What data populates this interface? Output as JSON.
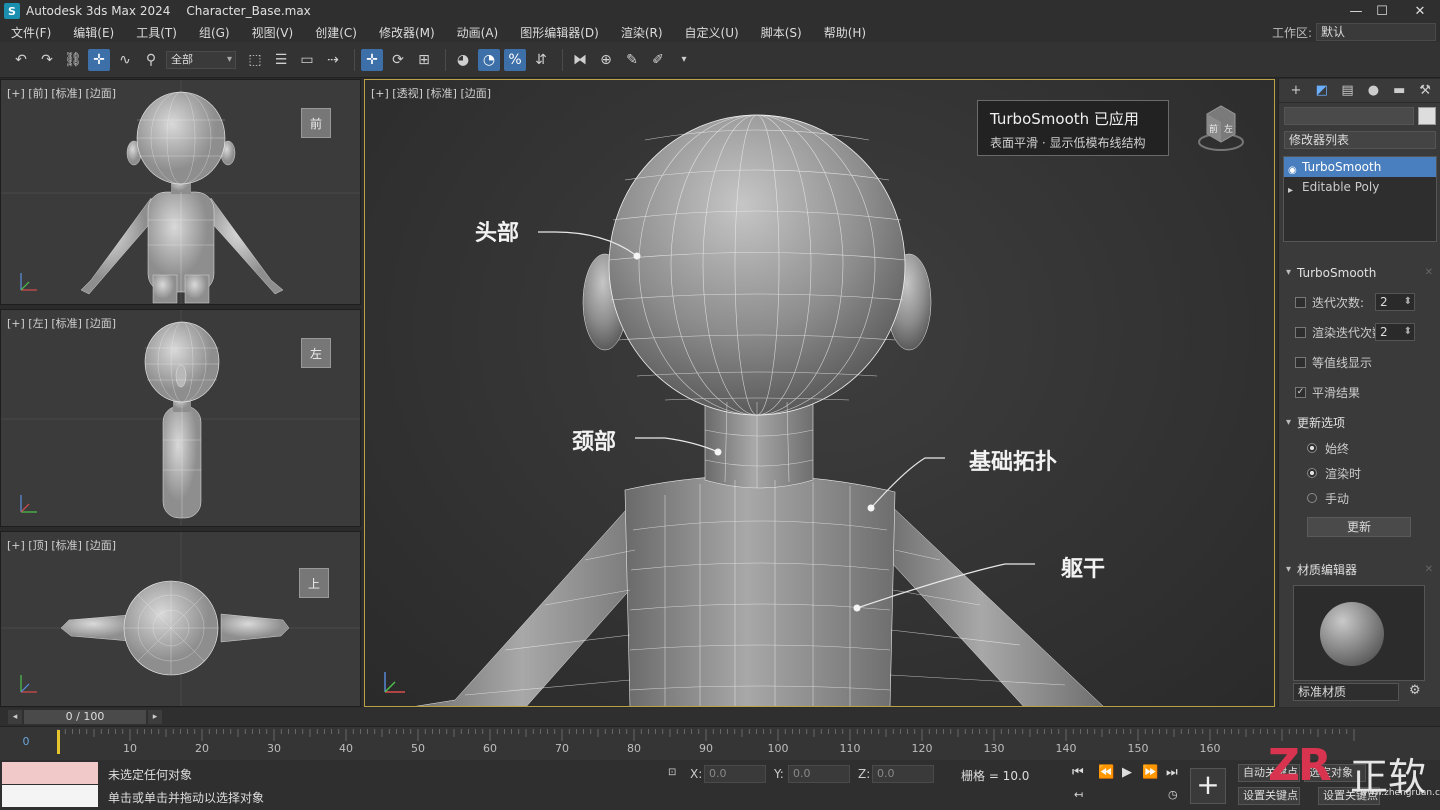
{
  "titlebar": {
    "app_name": "Autodesk 3ds Max 2024",
    "file_name": "Character_Base.max",
    "logo": "3ds-max-logo"
  },
  "menu": [
    "文件(F)",
    "编辑(E)",
    "工具(T)",
    "组(G)",
    "视图(V)",
    "创建(C)",
    "修改器(M)",
    "动画(A)",
    "图形编辑器(D)",
    "渲染(R)",
    "自定义(U)",
    "脚本(S)",
    "帮助(H)"
  ],
  "workspace": {
    "label": "工作区:",
    "value": "默认"
  },
  "toolbar": {
    "selection_filter": "全部"
  },
  "viewports": {
    "front": {
      "label": "[+] [前] [标准] [边面]",
      "cube": "前"
    },
    "left": {
      "label": "[+] [左] [标准] [边面]",
      "cube": "左"
    },
    "top": {
      "label": "[+] [顶] [标准] [边面]",
      "cube": "上"
    },
    "persp": {
      "label": "[+] [透视] [标准] [边面]",
      "cube_front": "左",
      "cube_side": "前"
    }
  },
  "callout": {
    "title": "TurboSmooth 已应用",
    "subtitle": "表面平滑 · 显示低模布线结构"
  },
  "annotations": {
    "head": "头部",
    "neck": "颈部",
    "topology": "基础拓扑",
    "torso": "躯干"
  },
  "command_panel": {
    "modifier_list": "修改器列表",
    "stack": [
      "TurboSmooth",
      "Editable Poly"
    ],
    "turbosmooth": {
      "title": "TurboSmooth",
      "iterations_label": "迭代次数:",
      "iterations_value": "2",
      "render_iters_label": "渲染迭代次数:",
      "render_iters_value": "2",
      "isoline_label": "等值线显示",
      "smooth_result_label": "平滑结果",
      "update_options_title": "更新选项",
      "update_always": "始终",
      "update_render": "渲染时",
      "update_manual": "手动",
      "update_button": "更新"
    },
    "material_editor": {
      "title": "材质编辑器",
      "type": "标准材质"
    }
  },
  "timeline": {
    "slider": "0 / 100",
    "cursor_frame": "0",
    "frames": [
      "10",
      "20",
      "30",
      "40",
      "50",
      "60",
      "70",
      "80",
      "90",
      "100",
      "110",
      "120",
      "130",
      "140",
      "150",
      "160"
    ]
  },
  "status": {
    "line1": "未选定任何对象",
    "line2": "单击或单击并拖动以选择对象",
    "x_label": "X:",
    "y_label": "Y:",
    "z_label": "Z:",
    "x_value": "0.0",
    "y_value": "0.0",
    "z_value": "0.0",
    "grid": "栅格 = 10.0",
    "auto_key": "自动关键点",
    "selected": "选定对象",
    "set_key": "设置关键点",
    "key_filters": "设置关键点"
  },
  "watermark": {
    "logo": "ZR",
    "text": "正软",
    "url": "www.zhengruan.com"
  }
}
